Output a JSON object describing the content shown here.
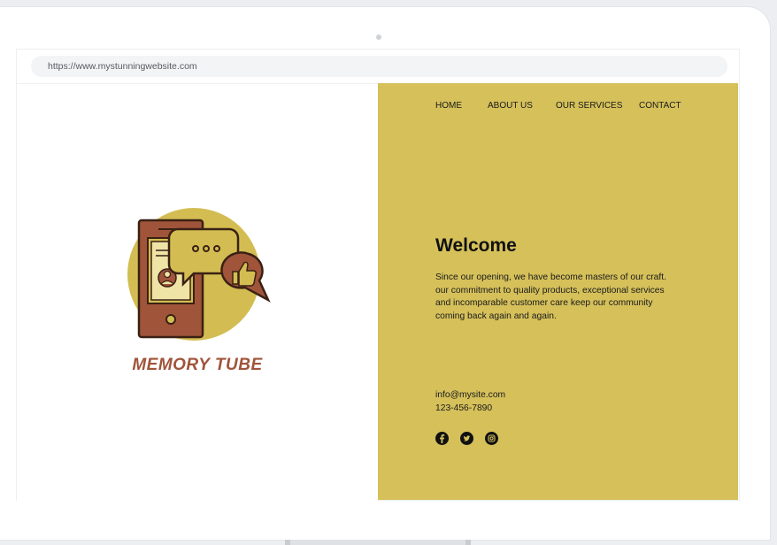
{
  "browser": {
    "url": "https://www.mystunningwebsite.com"
  },
  "site": {
    "brand_name": "MEMORY TUBE",
    "nav": [
      "HOME",
      "ABOUT US",
      "OUR SERVICES",
      "CONTACT"
    ],
    "heading": "Welcome",
    "description_lines": [
      "Since our opening, we have become masters of our craft.",
      "our commitment to quality products, exceptional services",
      "and incomparable customer care keep our community",
      "coming back again and again."
    ],
    "email": "info@mysite.com",
    "phone": "123-456-7890",
    "social_icons": [
      "facebook-icon",
      "twitter-icon",
      "instagram-icon"
    ]
  },
  "colors": {
    "panel": "#d5c05a",
    "brand_text": "#a0543a",
    "logo_circle": "#d3bd52",
    "logo_brown": "#a0543a",
    "logo_outline": "#3a2114"
  }
}
